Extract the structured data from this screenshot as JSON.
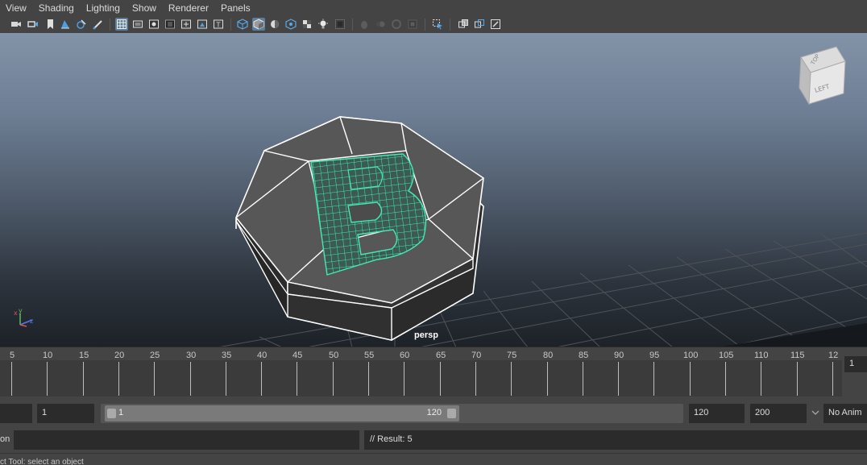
{
  "menu": [
    "View",
    "Shading",
    "Lighting",
    "Show",
    "Renderer",
    "Panels"
  ],
  "toolbar": {
    "icons": [
      "camera-select-icon",
      "camera-attributes-icon",
      "bookmark-icon",
      "image-plane-icon",
      "grease-pencil-icon",
      "grid-icon",
      "film-gate-icon",
      "resolution-gate-icon",
      "gate-mask-icon",
      "field-chart-icon",
      "safe-title-icon",
      "wireframe-icon",
      "smooth-shade-icon",
      "default-material-icon",
      "textured-icon",
      "use-all-lights-icon",
      "shadows-icon",
      "screen-space-ao-icon",
      "motion-blur-icon",
      "anti-aliasing-icon",
      "depth-of-field-icon",
      "isolate-select-icon",
      "xray-icon",
      "xray-joints-icon",
      "xray-active-icon"
    ]
  },
  "viewport": {
    "camera_label": "persp",
    "viewcube": {
      "top": "TOP",
      "left": "LEFT"
    }
  },
  "timeslider": {
    "tick_labels": [
      "5",
      "10",
      "15",
      "20",
      "25",
      "30",
      "35",
      "40",
      "45",
      "50",
      "55",
      "60",
      "65",
      "70",
      "75",
      "80",
      "85",
      "90",
      "95",
      "100",
      "105",
      "110",
      "115",
      "12"
    ],
    "current_frame": "1"
  },
  "range": {
    "start_field": "1",
    "bar_start": "1",
    "bar_end": "120",
    "end_field": "120",
    "anim_end": "200",
    "mode": "No Anim"
  },
  "command": {
    "label": "on",
    "result": "// Result: 5"
  },
  "help": {
    "text": "ct Tool: select an object"
  },
  "colors": {
    "accent": "#5d7e9b",
    "selection_green": "#44e8b0",
    "viewport_top": "#8293a8",
    "viewport_bottom": "#1d2228"
  }
}
